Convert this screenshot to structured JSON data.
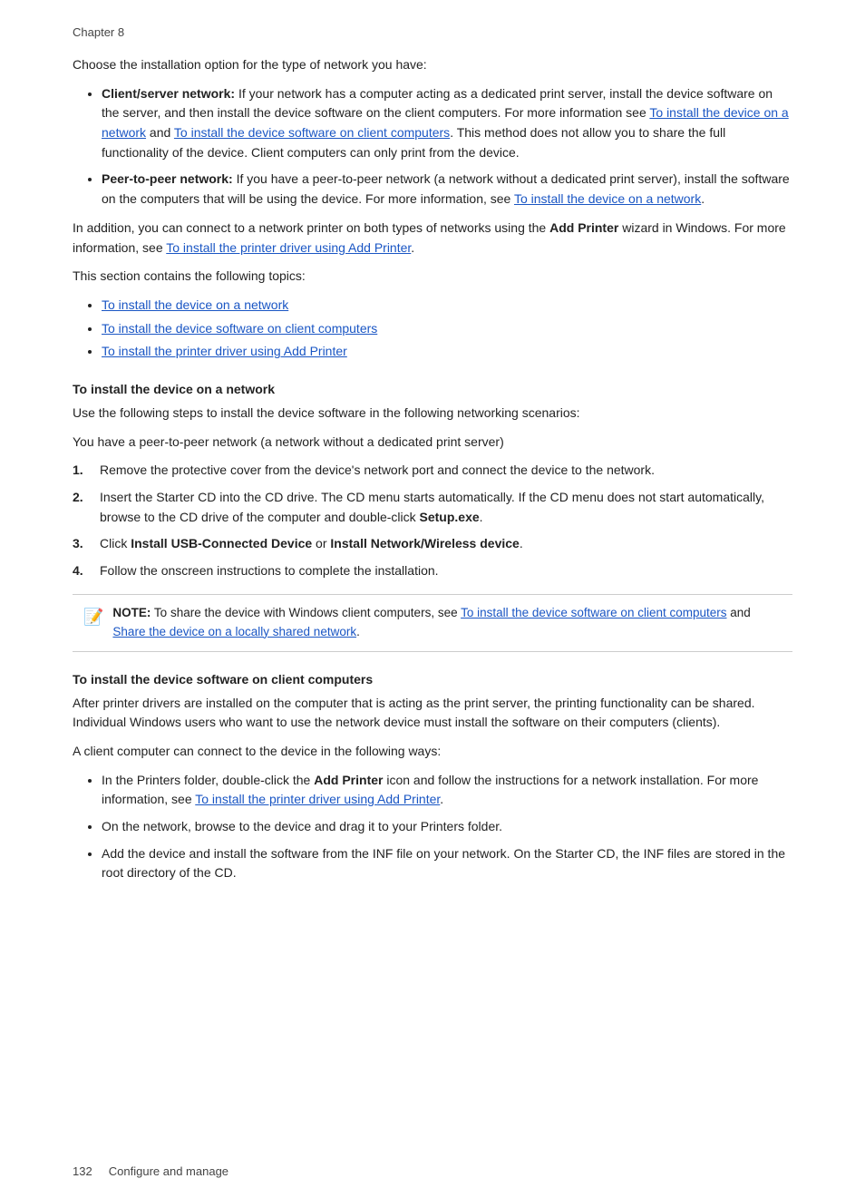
{
  "chapter": "Chapter 8",
  "intro_line": "Choose the installation option for the type of network you have:",
  "bullets": [
    {
      "term": "Client/server network:",
      "text": " If your network has a computer acting as a dedicated print server, install the device software on the server, and then install the device software on the client computers. For more information see ",
      "link1_text": "To install the device on a network",
      "mid_text": " and ",
      "link2_text": "To install the device software on client computers",
      "end_text": ". This method does not allow you to share the full functionality of the device. Client computers can only print from the device."
    },
    {
      "term": "Peer-to-peer network:",
      "text": " If you have a peer-to-peer network (a network without a dedicated print server), install the software on the computers that will be using the device. For more information, see ",
      "link1_text": "To install the device on a network",
      "end_text": "."
    }
  ],
  "add_printer_para": "In addition, you can connect to a network printer on both types of networks using the ",
  "add_printer_bold1": "Add Printer",
  "add_printer_para2": " wizard in Windows. For more information, see ",
  "add_printer_link": "To install the printer driver using Add Printer",
  "add_printer_end": ".",
  "topics_intro": "This section contains the following topics:",
  "topics": [
    "To install the device on a network",
    "To install the device software on client computers",
    "To install the printer driver using Add Printer"
  ],
  "section1_heading": "To install the device on a network",
  "section1_para1": "Use the following steps to install the device software in the following networking scenarios:",
  "section1_para2": "You have a peer-to-peer network (a network without a dedicated print server)",
  "section1_steps": [
    {
      "num": "1.",
      "text": "Remove the protective cover from the device's network port and connect the device to the network."
    },
    {
      "num": "2.",
      "text": "Insert the Starter CD into the CD drive. The CD menu starts automatically. If the CD menu does not start automatically, browse to the CD drive of the computer and double-click ",
      "bold_part": "Setup.exe",
      "after": "."
    },
    {
      "num": "3.",
      "text": "Click ",
      "bold1": "Install USB-Connected Device",
      "mid": " or ",
      "bold2": "Install Network/Wireless device",
      "after": "."
    },
    {
      "num": "4.",
      "text": "Follow the onscreen instructions to complete the installation."
    }
  ],
  "note_label": "NOTE:",
  "note_text": "  To share the device with Windows client computers, see ",
  "note_link1": "To install the device software on client computers",
  "note_mid": " and ",
  "note_link2": "Share the device on a locally shared network",
  "note_end": ".",
  "section2_heading": "To install the device software on client computers",
  "section2_para1": "After printer drivers are installed on the computer that is acting as the print server, the printing functionality can be shared. Individual Windows users who want to use the network device must install the software on their computers (clients).",
  "section2_para2": "A client computer can connect to the device in the following ways:",
  "section2_bullets": [
    {
      "text": "In the Printers folder, double-click the ",
      "bold": "Add Printer",
      "mid": " icon and follow the instructions for a network installation. For more information, see ",
      "link": "To install the printer driver using Add Printer",
      "end": "."
    },
    {
      "text": "On the network, browse to the device and drag it to your Printers folder."
    },
    {
      "text": "Add the device and install the software from the INF file on your network. On the Starter CD, the INF files are stored in the root directory of the CD."
    }
  ],
  "footer_page": "132",
  "footer_text": "Configure and manage"
}
